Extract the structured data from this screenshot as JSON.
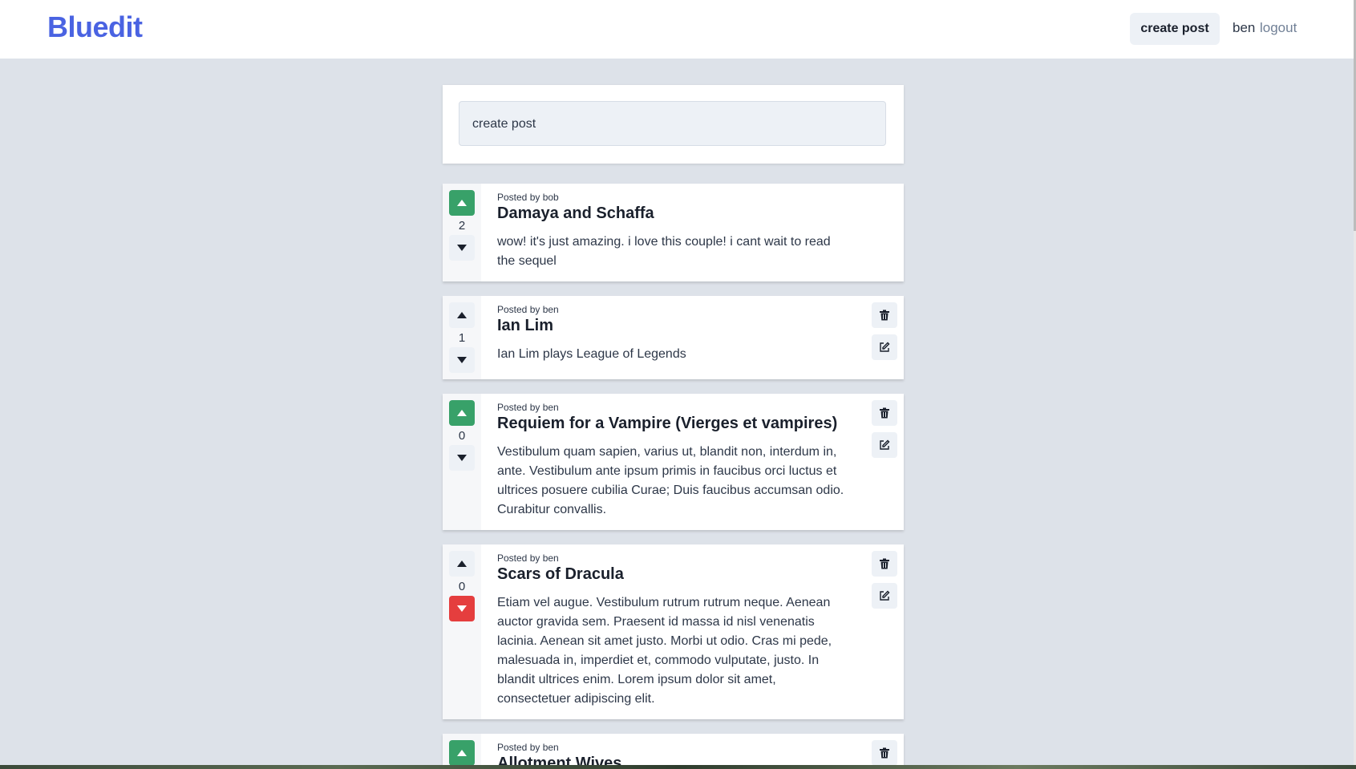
{
  "header": {
    "logo": "Bluedit",
    "create_post_label": "create post",
    "username": "ben",
    "logout_label": "logout"
  },
  "composer": {
    "placeholder": "create post"
  },
  "colors": {
    "brand": "#4a63e2",
    "upvoted": "#38a169",
    "downvoted": "#e53e3e"
  },
  "icons": {
    "upvote": "triangle-up-icon",
    "downvote": "triangle-down-icon",
    "delete": "trash-icon",
    "edit": "edit-icon"
  },
  "posts": [
    {
      "byline": "Posted by bob",
      "title": "Damaya and Schaffa",
      "body": "wow! it's just amazing. i love this couple! i cant wait to read the sequel",
      "votes": "2",
      "vote_state": "up",
      "owned": false
    },
    {
      "byline": "Posted by ben",
      "title": "Ian Lim",
      "body": "Ian Lim plays League of Legends",
      "votes": "1",
      "vote_state": "none",
      "owned": true
    },
    {
      "byline": "Posted by ben",
      "title": "Requiem for a Vampire (Vierges et vampires)",
      "body": "Vestibulum quam sapien, varius ut, blandit non, interdum in, ante. Vestibulum ante ipsum primis in faucibus orci luctus et ultrices posuere cubilia Curae; Duis faucibus accumsan odio. Curabitur convallis.",
      "votes": "0",
      "vote_state": "up",
      "owned": true
    },
    {
      "byline": "Posted by ben",
      "title": "Scars of Dracula",
      "body": "Etiam vel augue. Vestibulum rutrum rutrum neque. Aenean auctor gravida sem. Praesent id massa id nisl venenatis lacinia. Aenean sit amet justo. Morbi ut odio. Cras mi pede, malesuada in, imperdiet et, commodo vulputate, justo. In blandit ultrices enim. Lorem ipsum dolor sit amet, consectetuer adipiscing elit.",
      "votes": "0",
      "vote_state": "down",
      "owned": true
    },
    {
      "byline": "Posted by ben",
      "title": "Allotment Wives",
      "body": "",
      "votes": "",
      "vote_state": "up",
      "owned": true
    }
  ]
}
